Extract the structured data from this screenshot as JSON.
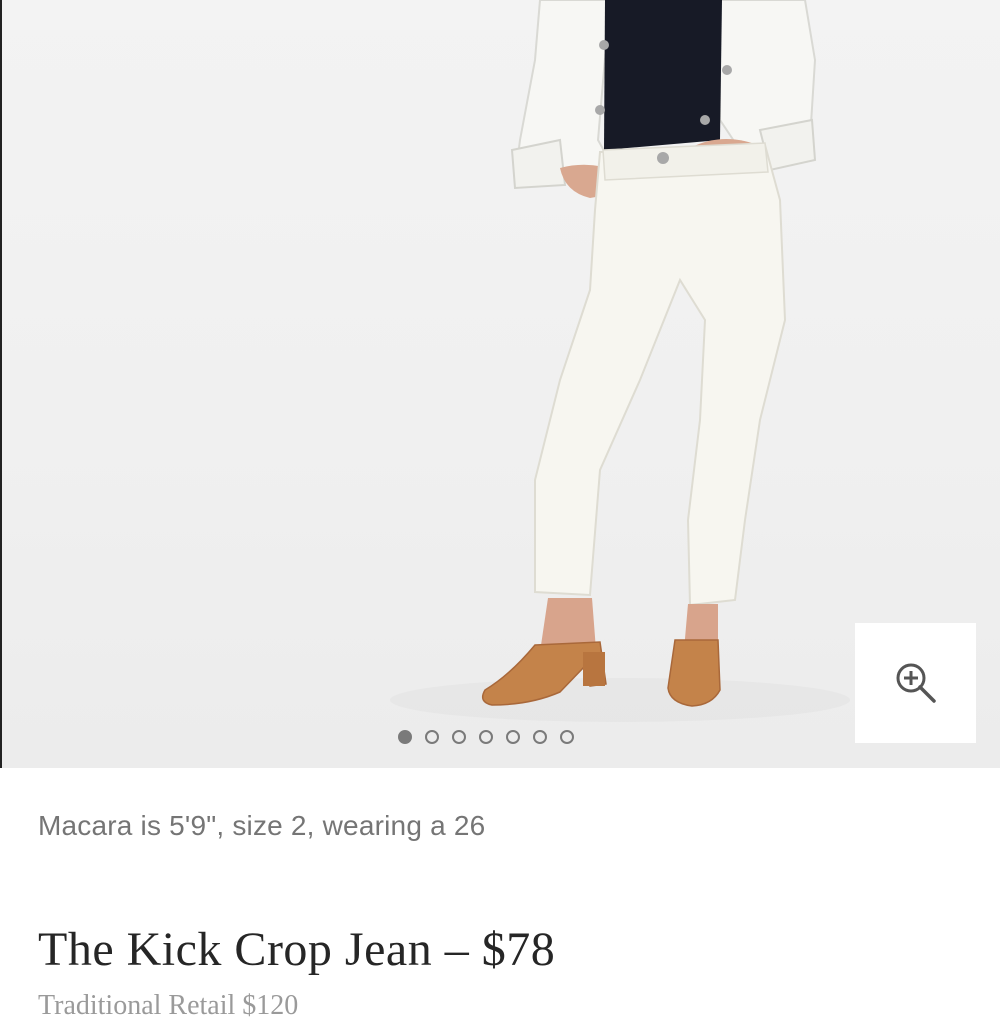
{
  "product": {
    "model_caption": "Macara is 5'9\", size 2, wearing a 26",
    "title": "The Kick Crop Jean – $78",
    "subtitle_partial": "Traditional Retail $120"
  },
  "gallery": {
    "image_count": 7,
    "active_index": 0,
    "zoom_icon": "zoom-in-icon"
  },
  "colors": {
    "background": "#ffffff",
    "text_muted": "#757575",
    "text_dark": "#262626"
  }
}
